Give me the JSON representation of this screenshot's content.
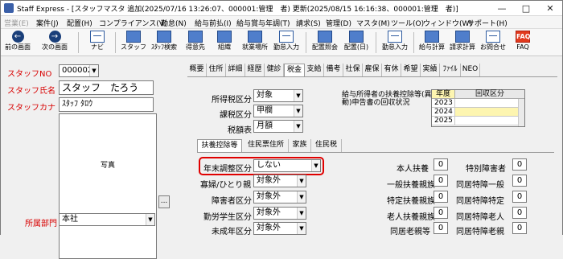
{
  "window": {
    "title": "Staff Express - [スタッフマスタ 追加(2025/07/16 13:26:07、000001:管理　者) 更新(2025/08/15 16:16:38、000001:管理　者)]"
  },
  "menu": [
    "営業(E)",
    "案件(J)",
    "配置(H)",
    "コンプライアンス(V)",
    "勤怠(N)",
    "給与前払(I)",
    "給与賞与年調(T)",
    "請求(S)",
    "管理(D)",
    "マスタ(M)",
    "ツール(O)",
    "ウィンドウ(W)",
    "サポート(H)"
  ],
  "toolbar": [
    {
      "label": "前の画面",
      "icon": "prev-arrow-icon"
    },
    {
      "label": "次の画面",
      "icon": "next-arrow-icon"
    },
    {
      "label": "ナビ",
      "icon": "navi-icon"
    },
    {
      "label": "スタッフ",
      "icon": "staff-icon"
    },
    {
      "label": "ｽﾀｯﾌ検索",
      "icon": "staff-search-icon"
    },
    {
      "label": "得意先",
      "icon": "client-icon"
    },
    {
      "label": "組織",
      "icon": "organization-icon"
    },
    {
      "label": "就業場所",
      "icon": "workplace-icon"
    },
    {
      "label": "勤怠入力",
      "icon": "attendance-input-icon"
    },
    {
      "label": "配置照会",
      "icon": "placement-inquiry-icon"
    },
    {
      "label": "配置(日)",
      "icon": "placement-daily-icon"
    },
    {
      "label": "勤怠入力",
      "icon": "attendance-input-icon"
    },
    {
      "label": "給与計算",
      "icon": "payroll-icon"
    },
    {
      "label": "請求計算",
      "icon": "billing-icon"
    },
    {
      "label": "お問合せ",
      "icon": "inquiry-icon"
    },
    {
      "label": "FAQ",
      "icon": "faq-icon"
    }
  ],
  "staff": {
    "no_label": "スタッフNO",
    "no_value": "000002",
    "name_label": "スタッフ氏名",
    "name_value": "スタッフ　たろう",
    "kana_label": "スタッフカナ",
    "kana_value": "ｽﾀｯﾌ ﾀﾛｳ",
    "photo_label": "写真",
    "photo_button": "...",
    "dept_label": "所属部門",
    "dept_value": "本社"
  },
  "tabs": [
    "概要",
    "住所",
    "詳細",
    "経歴",
    "健診",
    "税金",
    "支給",
    "備考",
    "社保",
    "雇保",
    "有休",
    "希望",
    "実績",
    "ﾌｧｲﾙ",
    "NEO"
  ],
  "active_tab": "税金",
  "tax": {
    "income_tax_label": "所得税区分",
    "income_tax_value": "対象",
    "tax_class_label": "課税区分",
    "tax_class_value": "甲欄",
    "tax_table_label": "税額表",
    "tax_table_value": "月額",
    "dependent_title": "給与所得者の扶養控除等(異動)申告書の回収状況",
    "grid_headers": [
      "年度",
      "回収区分"
    ],
    "grid_years": [
      "2023",
      "2024",
      "2025"
    ]
  },
  "subtabs": [
    "扶養控除等",
    "住民票住所",
    "家族",
    "住民税"
  ],
  "deductions": [
    {
      "label": "年末調整区分",
      "value": "しない"
    },
    {
      "label": "寡婦/ひとり親",
      "value": "対象外"
    },
    {
      "label": "障害者区分",
      "value": "対象外"
    },
    {
      "label": "勤労学生区分",
      "value": "対象外"
    },
    {
      "label": "未成年区分",
      "value": "対象外"
    }
  ],
  "dependents": [
    {
      "label": "本人扶養",
      "value": "0"
    },
    {
      "label": "一般扶養親族",
      "value": "0"
    },
    {
      "label": "特定扶養親族",
      "value": "0"
    },
    {
      "label": "老人扶養親族",
      "value": "0"
    },
    {
      "label": "同居老親等",
      "value": "0"
    }
  ],
  "disabled_counts": [
    {
      "label": "特別障害者",
      "value": "0"
    },
    {
      "label": "同居特障一般",
      "value": "0"
    },
    {
      "label": "同居特障特定",
      "value": "0"
    },
    {
      "label": "同居特障老人",
      "value": "0"
    },
    {
      "label": "同居特障老親",
      "value": "0"
    }
  ],
  "colors": {
    "accent_red": "#d80000",
    "header_yellow": "#fdf5b0",
    "grid_header": "#e8e8e8"
  }
}
